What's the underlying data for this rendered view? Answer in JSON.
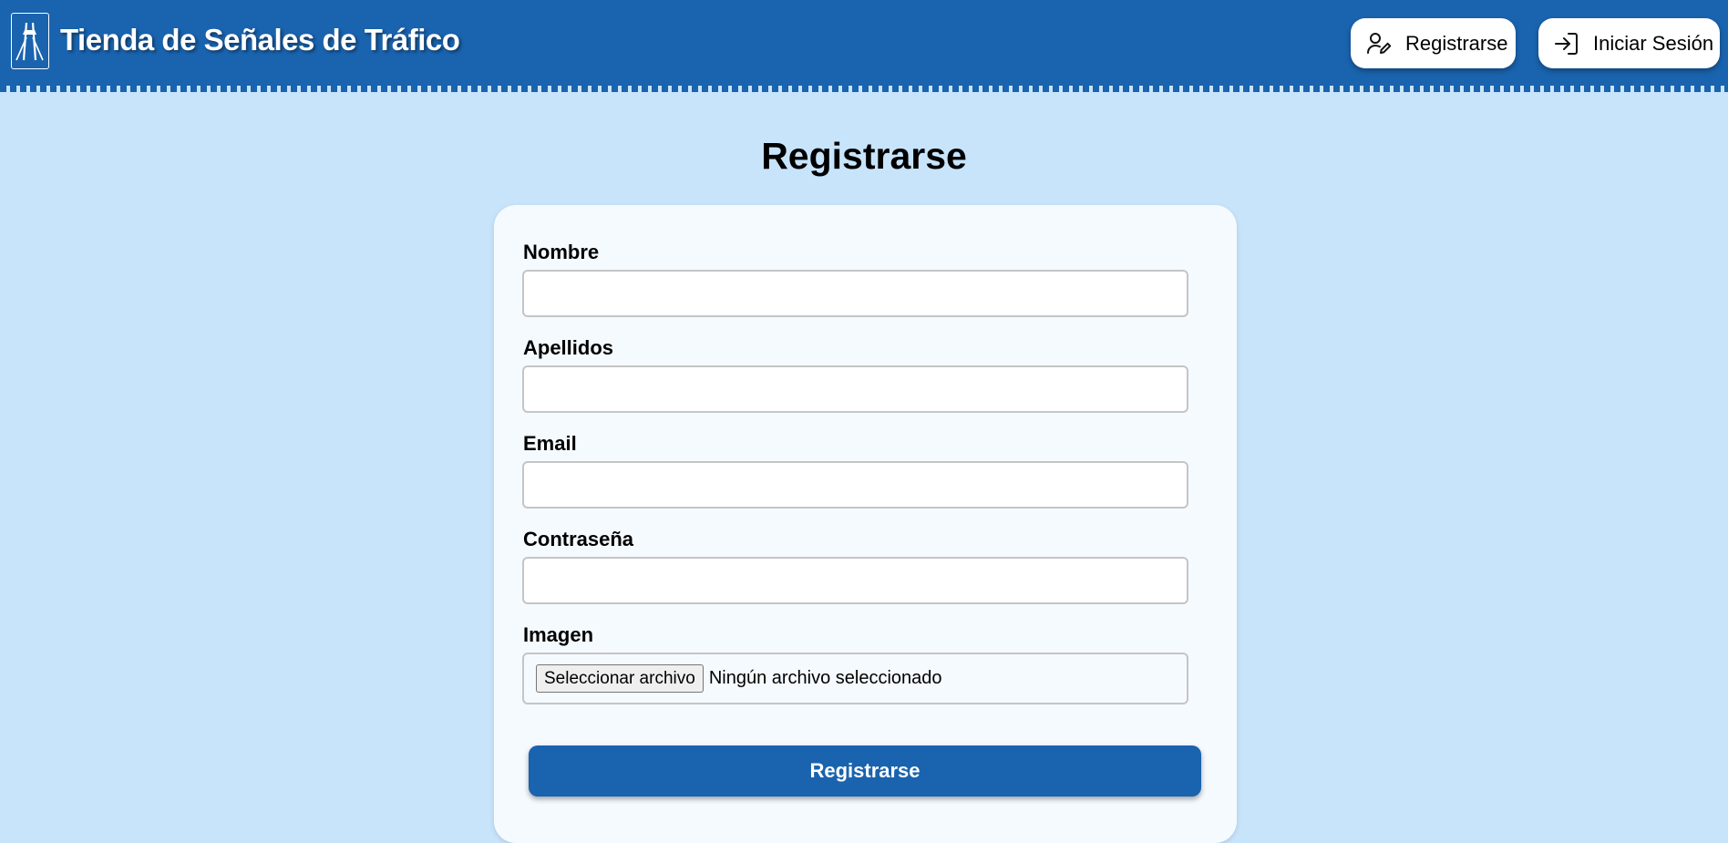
{
  "header": {
    "brand": "Tienda de Señales de Tráfico",
    "logo_icon": "highway-sign-icon",
    "register_label": "Registrarse",
    "register_icon": "user-edit-icon",
    "login_label": "Iniciar Sesión",
    "login_icon": "login-arrow-icon",
    "color": "#1a63ae"
  },
  "page": {
    "title": "Registrarse",
    "background": "#c8e4fb"
  },
  "form": {
    "fields": [
      {
        "label": "Nombre",
        "value": "",
        "type": "text"
      },
      {
        "label": "Apellidos",
        "value": "",
        "type": "text"
      },
      {
        "label": "Email",
        "value": "",
        "type": "email"
      },
      {
        "label": "Contraseña",
        "value": "",
        "type": "password"
      }
    ],
    "image": {
      "label": "Imagen",
      "button_label": "Seleccionar archivo",
      "status": "Ningún archivo seleccionado"
    },
    "submit_label": "Registrarse"
  }
}
